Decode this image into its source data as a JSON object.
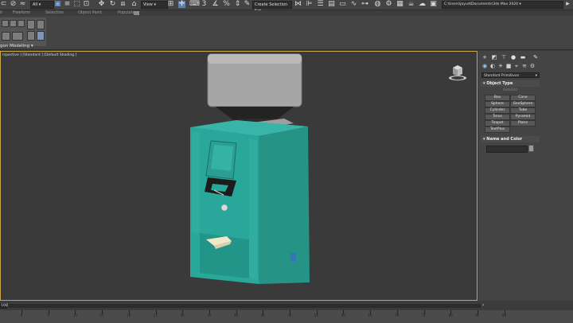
{
  "toolbar": {
    "filter_value": "All",
    "view_value": "View",
    "selection_set_placeholder": "Create Selection Set",
    "project_path": "C:\\Users\\joyud\\Documents\\3ds Max 2020"
  },
  "ribbon": {
    "tabs": [
      "ll",
      "Freeform",
      "Selection",
      "Object Paint",
      "Populate"
    ],
    "active_panel_label": "gon Modeling  ▾"
  },
  "viewport": {
    "label": "[+] [Perspective ] [Standard ] [Default Shading ]",
    "label_visible": "rspective ] [Standard ] [Default Shading ]",
    "border_color": "#c9a64a"
  },
  "command_panel": {
    "category_dropdown": "Standard Primitives",
    "object_type_title": "Object Type",
    "autogrid_label": "AutoGrid",
    "primitives": [
      "Box",
      "Cone",
      "Sphere",
      "GeoSphere",
      "Cylinder",
      "Tube",
      "Torus",
      "Pyramid",
      "Teapot",
      "Plane",
      "TextPlus"
    ],
    "name_color_title": "Name and Color"
  },
  "timeline": {
    "frame_value": "100",
    "ruler_labels": [
      "0",
      "5",
      "10",
      "15",
      "20",
      "25",
      "30",
      "35",
      "40",
      "45",
      "50",
      "55",
      "60",
      "65",
      "70",
      "75",
      "80",
      "85",
      "90"
    ]
  },
  "colors": {
    "model_body": "#2aa79b",
    "hopper": "#a6a6a6",
    "viewport_bg": "#3a3a3a",
    "active_border": "#c9a64a"
  }
}
